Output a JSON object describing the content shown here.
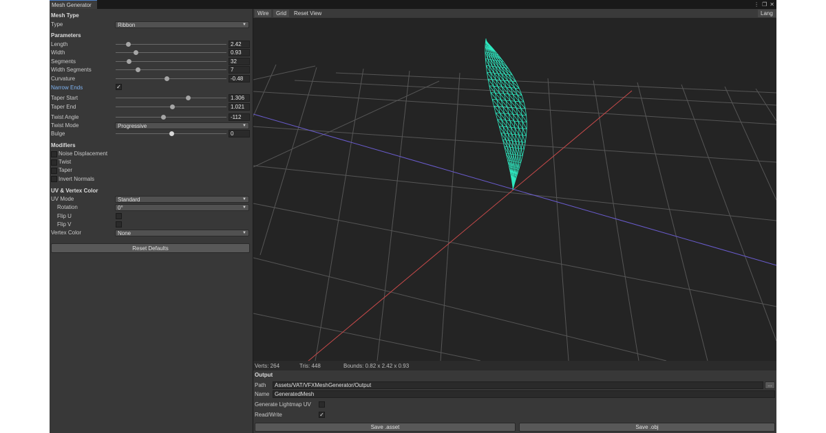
{
  "window": {
    "tab_label": "Mesh Generator",
    "more_glyph": "⋮",
    "restore_glyph": "❐",
    "close_glyph": "✕"
  },
  "left": {
    "mesh_type": {
      "section": "Mesh Type",
      "type_label": "Type",
      "type_value": "Ribbon"
    },
    "parameters": {
      "section": "Parameters",
      "length": {
        "label": "Length",
        "value": "2.42",
        "fraction": 0.11
      },
      "width": {
        "label": "Width",
        "value": "0.93",
        "fraction": 0.18
      },
      "segments": {
        "label": "Segments",
        "value": "32",
        "fraction": 0.12
      },
      "width_segments": {
        "label": "Width Segments",
        "value": "7",
        "fraction": 0.2
      },
      "curvature": {
        "label": "Curvature",
        "value": "-0.48",
        "fraction": 0.46
      },
      "narrow_ends": {
        "label": "Narrow Ends",
        "checked": true,
        "check_glyph": "✓"
      },
      "taper_start": {
        "label": "Taper Start",
        "value": "1.306",
        "fraction": 0.65
      },
      "taper_end": {
        "label": "Taper End",
        "value": "1.021",
        "fraction": 0.51
      },
      "twist_angle": {
        "label": "Twist Angle",
        "value": "-112",
        "fraction": 0.43
      },
      "twist_mode": {
        "label": "Twist Mode",
        "value": "Progressive"
      },
      "bulge": {
        "label": "Bulge",
        "value": "0",
        "fraction": 0.5
      }
    },
    "modifiers": {
      "section": "Modifiers",
      "items": [
        {
          "label": "Noise Displacement",
          "checked": false
        },
        {
          "label": "Twist",
          "checked": false
        },
        {
          "label": "Taper",
          "checked": false
        },
        {
          "label": "Invert Normals",
          "checked": false
        }
      ]
    },
    "uv": {
      "section": "UV & Vertex Color",
      "uv_mode": {
        "label": "UV Mode",
        "value": "Standard"
      },
      "rotation": {
        "label": "Rotation",
        "value": "0°"
      },
      "flip_u": {
        "label": "Flip U",
        "checked": false
      },
      "flip_v": {
        "label": "Flip V",
        "checked": false
      },
      "vertex_color": {
        "label": "Vertex Color",
        "value": "None"
      }
    },
    "reset_button": "Reset Defaults"
  },
  "viewport": {
    "toolbar": {
      "wire": "Wire",
      "grid": "Grid",
      "reset_view": "Reset View",
      "lang": "Lang"
    },
    "mesh_color": "#2ee8c0",
    "status": {
      "verts": "Verts: 264",
      "tris": "Tris: 448",
      "bounds": "Bounds: 0.82 x 2.42 x 0.93"
    }
  },
  "output": {
    "section": "Output",
    "path_label": "Path",
    "path_value": "Assets/VAT/VFXMeshGenerator/Output",
    "browse": "...",
    "name_label": "Name",
    "name_value": "GeneratedMesh",
    "lightmap_label": "Generate Lightmap UV",
    "lightmap_checked": false,
    "readwrite_label": "Read/Write",
    "readwrite_checked": true,
    "check_glyph": "✓",
    "save_asset": "Save .asset",
    "save_obj": "Save .obj"
  },
  "colors": {
    "accent": "#4a7fc8",
    "x_axis": "#c84a4a",
    "z_axis": "#6a5ccf"
  }
}
